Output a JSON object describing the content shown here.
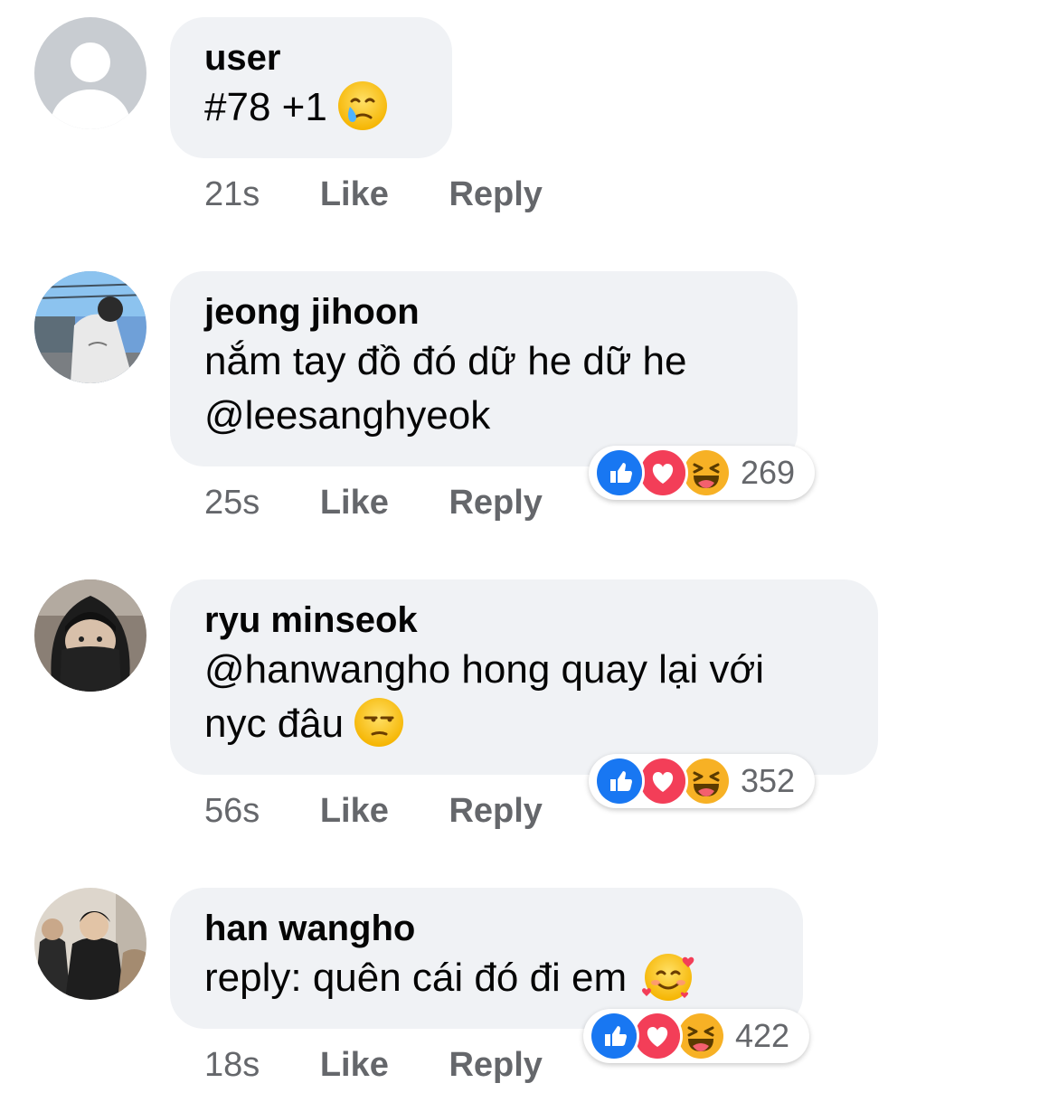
{
  "comments": [
    {
      "name": "user",
      "text": "#78 +1",
      "emoji": "crying-face",
      "time": "21s",
      "like_label": "Like",
      "reply_label": "Reply",
      "avatar": "default-avatar"
    },
    {
      "name": "jeong jihoon",
      "text_line1": "nắm tay đồ đó dữ he dữ he",
      "text_line2": "@leesanghyeok",
      "time": "25s",
      "like_label": "Like",
      "reply_label": "Reply",
      "reaction_count": "269",
      "avatar": "photo-avatar"
    },
    {
      "name": "ryu minseok",
      "text_line1": "@hanwangho hong quay lại với",
      "text_line2": "nyc đâu",
      "emoji": "unamused-face",
      "time": "56s",
      "like_label": "Like",
      "reply_label": "Reply",
      "reaction_count": "352",
      "avatar": "photo-avatar"
    },
    {
      "name": "han wangho",
      "text": "reply: quên cái đó đi em",
      "emoji": "smiling-face-with-hearts",
      "time": "18s",
      "like_label": "Like",
      "reply_label": "Reply",
      "reaction_count": "422",
      "avatar": "photo-avatar"
    }
  ],
  "reactions": [
    "like-icon",
    "love-icon",
    "haha-icon"
  ],
  "colors": {
    "bubble": "#f0f2f5",
    "meta_text": "#65676b",
    "like_blue": "#1877f2",
    "love_red": "#f33e58",
    "haha_yellow": "#f7b125"
  }
}
